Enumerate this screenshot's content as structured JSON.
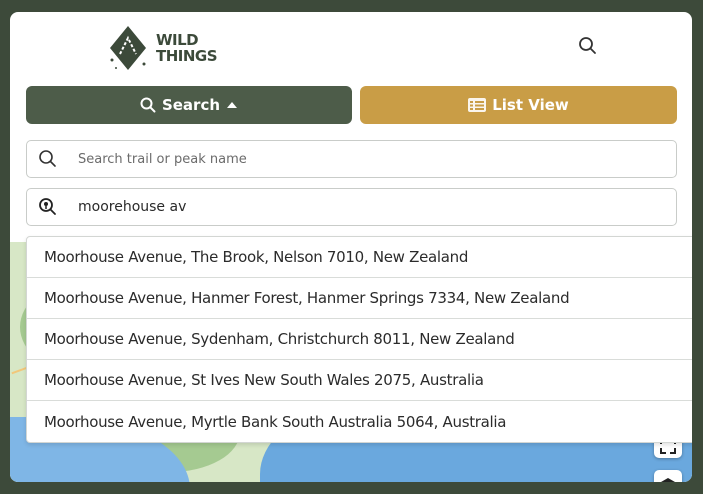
{
  "header": {
    "logo_line1": "WILD",
    "logo_line2": "THINGS",
    "search_icon": "search-icon"
  },
  "buttons": {
    "search_label": "Search",
    "list_view_label": "List View"
  },
  "fields": {
    "name_placeholder": "Search trail or peak name",
    "location_value": "moorehouse av"
  },
  "results": [
    "Moorhouse Avenue, The Brook, Nelson 7010, New Zealand",
    "Moorhouse Avenue, Hanmer Forest, Hanmer Springs 7334, New Zealand",
    "Moorhouse Avenue, Sydenham, Christchurch 8011, New Zealand",
    "Moorhouse Avenue, St Ives New South Wales 2075, Australia",
    "Moorhouse Avenue, Myrtle Bank South Australia 5064, Australia"
  ],
  "colors": {
    "background": "#3d4a3a",
    "search_button": "#4d5c49",
    "list_button": "#c99d46"
  }
}
